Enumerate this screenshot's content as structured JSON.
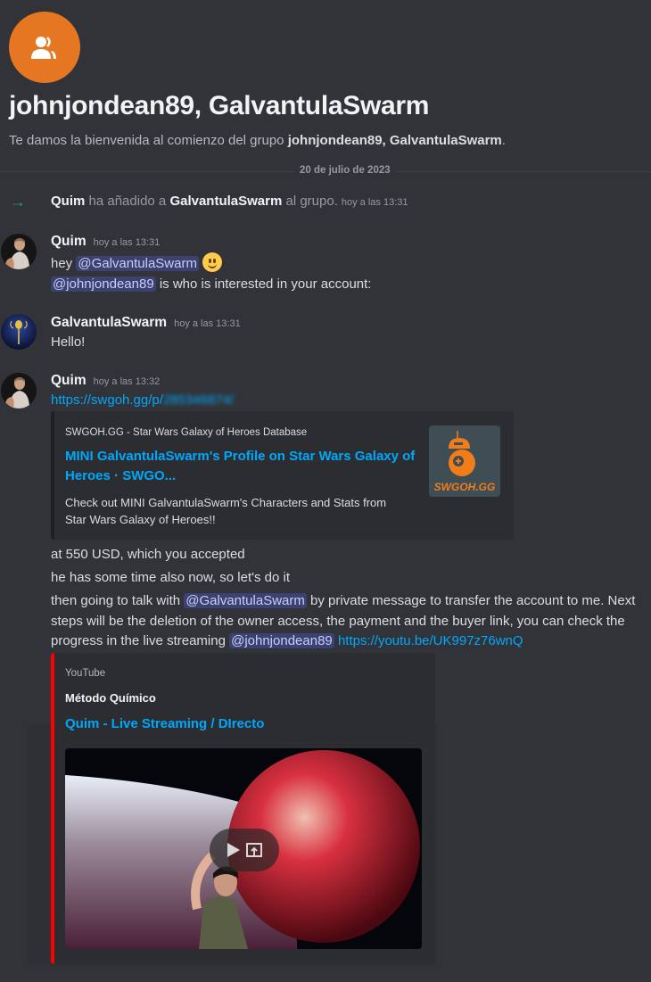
{
  "header": {
    "icon": "group-users-icon",
    "title": "johnjondean89, GalvantulaSwarm",
    "welcome_prefix": "Te damos la bienvenida al comienzo del grupo ",
    "welcome_group": "johnjondean89, GalvantulaSwarm",
    "welcome_suffix": "."
  },
  "date_divider": "20 de julio de 2023",
  "system_message": {
    "icon": "arrow-right-icon",
    "actor": "Quim",
    "action": " ha añadido a ",
    "target": "GalvantulaSwarm",
    "suffix": " al grupo.",
    "timestamp": "hoy a las 13:31"
  },
  "messages": [
    {
      "author": "Quim",
      "timestamp": "hoy a las 13:31",
      "line1_prefix": "hey ",
      "line1_mention": "@GalvantulaSwarm",
      "line1_emoji": "slightly-smiling-face",
      "line2_mention": "@johnjondean89",
      "line2_text": " is who is interested in your account:"
    },
    {
      "author": "GalvantulaSwarm",
      "timestamp": "hoy a las 13:31",
      "text": "Hello!"
    },
    {
      "author": "Quim",
      "timestamp": "hoy a las 13:32",
      "link_visible": "https://swgoh.gg/p/",
      "link_blurred": "285346874/",
      "embed": {
        "provider": "SWGOH.GG - Star Wars Galaxy of Heroes Database",
        "title_line1": "MINI GalvantulaSwarm's Profile on Star Wars Galaxy of",
        "title_line2": "Heroes · SWGO...",
        "desc_line1": "Check out MINI GalvantulaSwarm's Characters and Stats from",
        "desc_line2": "Star Wars Galaxy of Heroes!!",
        "thumbnail_text": "SWGOH.GG",
        "accent": "#e67722"
      },
      "followups": [
        "at 550 USD, which you accepted",
        "he has some time also now, so let's do it"
      ],
      "long_message": {
        "l1_prefix": "then going to talk with ",
        "l1_mention": "@GalvantulaSwarm",
        "l1_suffix": " by private message to transfer the account to me. Next",
        "l2": "steps will be the deletion of the owner access, the payment and the buyer link, you can check the",
        "l3_prefix": "progress in the live streaming ",
        "l3_mention": "@johnjondean89",
        "l3_link": "https://youtu.be/UK997z76wnQ"
      },
      "youtube_embed": {
        "provider": "YouTube",
        "author": "Método Químico",
        "title": "Quim - Live Streaming / DIrecto",
        "border_color": "#ff0000",
        "play_icon": "play-icon",
        "open_icon": "open-external-icon"
      }
    }
  ]
}
